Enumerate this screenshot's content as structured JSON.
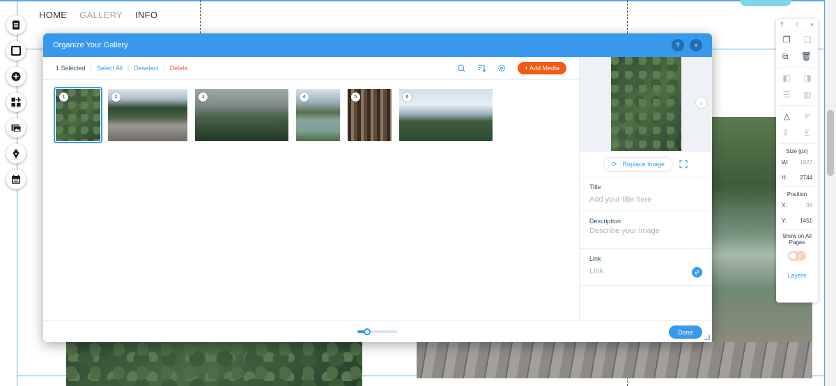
{
  "site_nav": [
    {
      "label": "HOME"
    },
    {
      "label": "GALLERY"
    },
    {
      "label": "INFO"
    }
  ],
  "left_tools": [
    "pages-icon",
    "background-icon",
    "add-icon",
    "app-market-icon",
    "media-icon",
    "blog-pen-icon",
    "bookings-icon"
  ],
  "right_panel": {
    "help": "?",
    "close": "×",
    "rotation": "0°",
    "size_label": "Size (px)",
    "w_label": "W:",
    "w_value": "1827",
    "h_label": "H:",
    "h_value": "2744",
    "position_label": "Position",
    "x_label": "X:",
    "x_value": "38",
    "y_label": "Y:",
    "y_value": "1451",
    "show_on_all_pages": "Show on All Pages",
    "layers": "Layers"
  },
  "dialog": {
    "title": "Organize Your Gallery",
    "help": "?",
    "close": "×",
    "toolbar": {
      "selected_count": "1 Selected",
      "select_all": "Select All",
      "deselect": "Deselect",
      "delete": "Delete",
      "add_media": "+ Add Media"
    },
    "thumbnails": [
      {
        "number": "1",
        "selected": true
      },
      {
        "number": "2",
        "selected": false
      },
      {
        "number": "3",
        "selected": false
      },
      {
        "number": "4",
        "selected": false
      },
      {
        "number": "5",
        "selected": false
      },
      {
        "number": "6",
        "selected": false
      }
    ],
    "details": {
      "replace_image": "Replace Image",
      "title_label": "Title",
      "title_placeholder": "Add your title here",
      "description_label": "Description",
      "description_placeholder": "Describe your image",
      "link_label": "Link",
      "link_placeholder": "Link"
    },
    "footer": {
      "zoom_level": 0.25,
      "done": "Done"
    }
  },
  "colors": {
    "accent": "#3899ec",
    "add_media": "#f05a14",
    "delete": "#e05a3a"
  }
}
